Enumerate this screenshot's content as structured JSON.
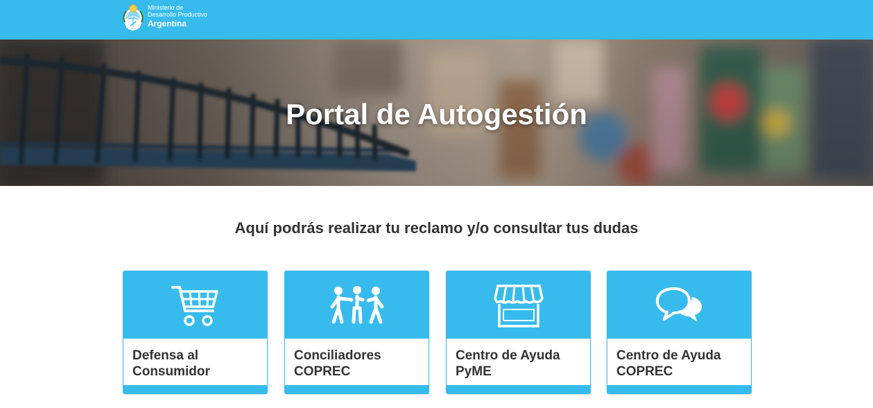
{
  "header": {
    "brand": {
      "line1": "Ministerio de",
      "line2": "Desarrollo Productivo",
      "line3": "Argentina",
      "logo_icon": "escudo-argentina-icon"
    },
    "background_color": "#37bbed"
  },
  "hero": {
    "title": "Portal de Autogestión"
  },
  "main": {
    "subtitle": "Aquí podrás realizar tu reclamo y/o consultar tus dudas"
  },
  "cards": [
    {
      "icon": "shopping-cart-icon",
      "line1": "Defensa al",
      "line2": "Consumidor"
    },
    {
      "icon": "people-group-icon",
      "line1": "Conciliadores",
      "line2": "COPREC"
    },
    {
      "icon": "storefront-icon",
      "line1": "Centro de Ayuda",
      "line2": "PyME"
    },
    {
      "icon": "chat-bubbles-icon",
      "line1": "Centro de Ayuda",
      "line2": "COPREC"
    }
  ],
  "colors": {
    "accent": "#37bbed",
    "text": "#333333"
  }
}
